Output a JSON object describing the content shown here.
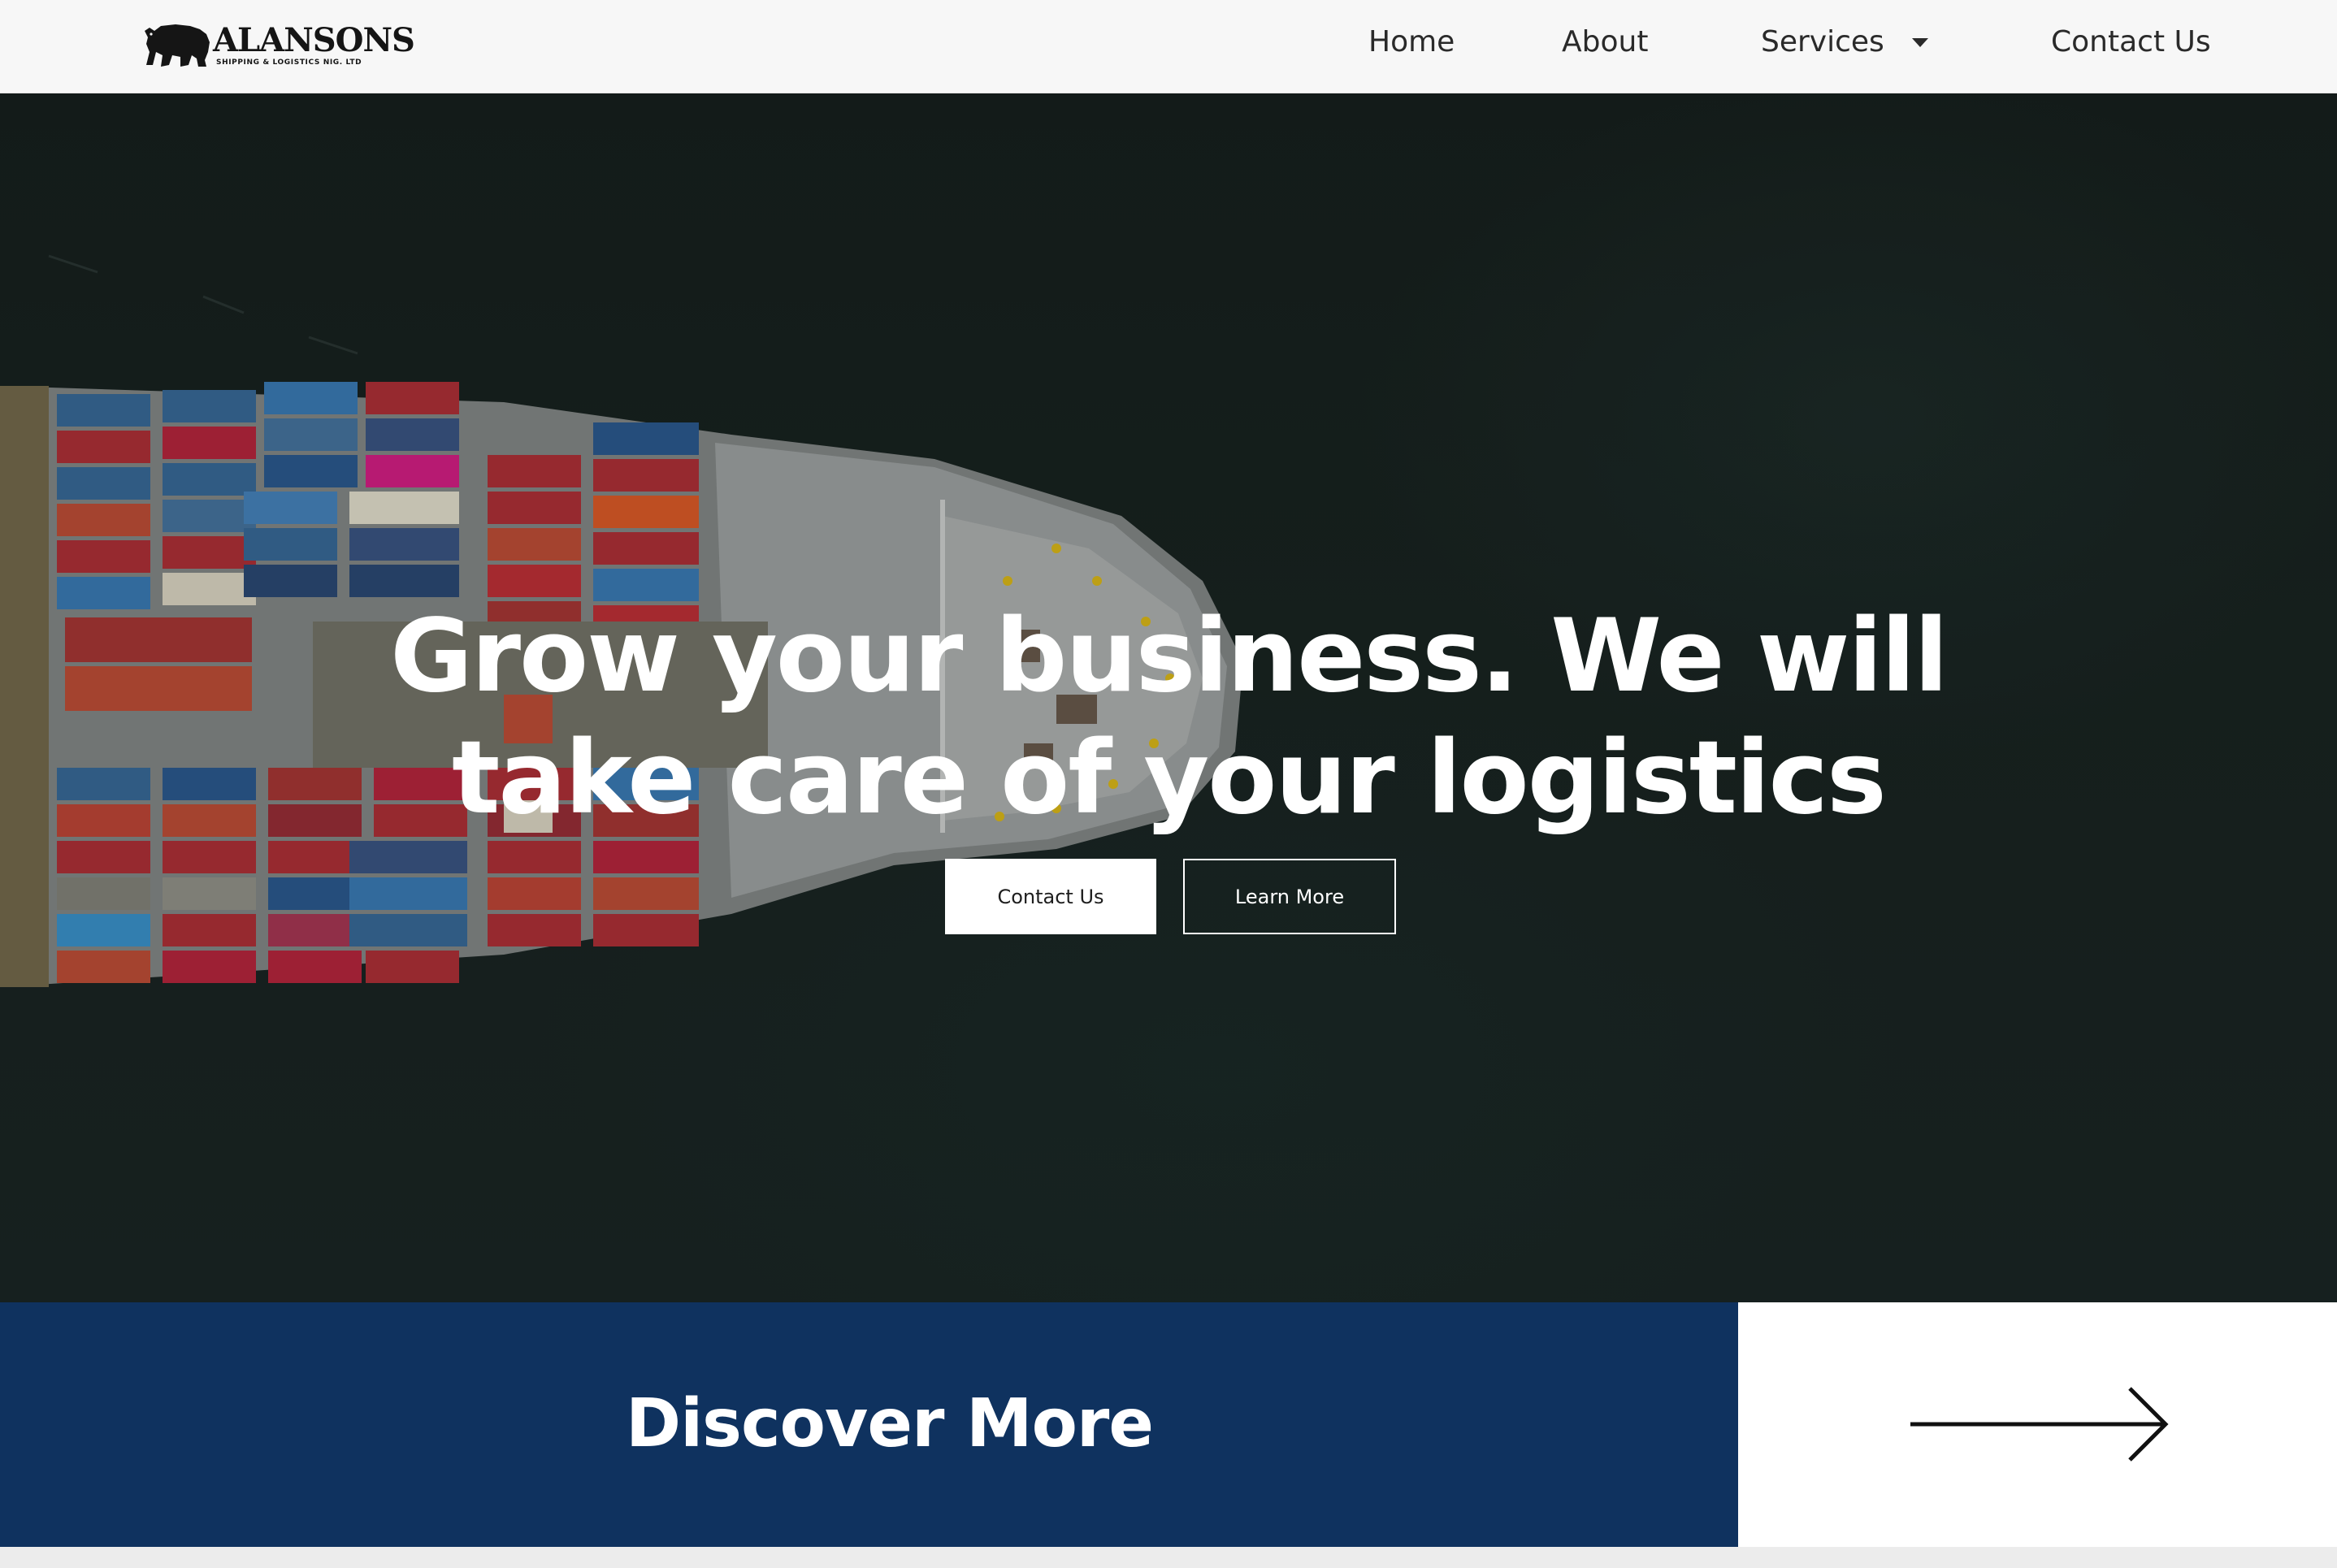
{
  "header": {
    "logo": {
      "name": "ALANSONS",
      "tagline": "SHIPPING & LOGISTICS NIG. LTD"
    },
    "nav": {
      "home": "Home",
      "about": "About",
      "services": "Services",
      "contact": "Contact Us"
    }
  },
  "hero": {
    "title_line1": "Grow your business. We will",
    "title_line2": "take care of your logistics",
    "buttons": {
      "contact": "Contact Us",
      "learn_more": "Learn More"
    }
  },
  "discover": {
    "label": "Discover More"
  },
  "colors": {
    "navy": "#0f325f",
    "header_bg": "#f7f7f7",
    "hero_water": "#1a2623",
    "white": "#ffffff"
  },
  "icons": [
    "bear-logo-icon",
    "chevron-down-icon",
    "arrow-right-icon"
  ]
}
